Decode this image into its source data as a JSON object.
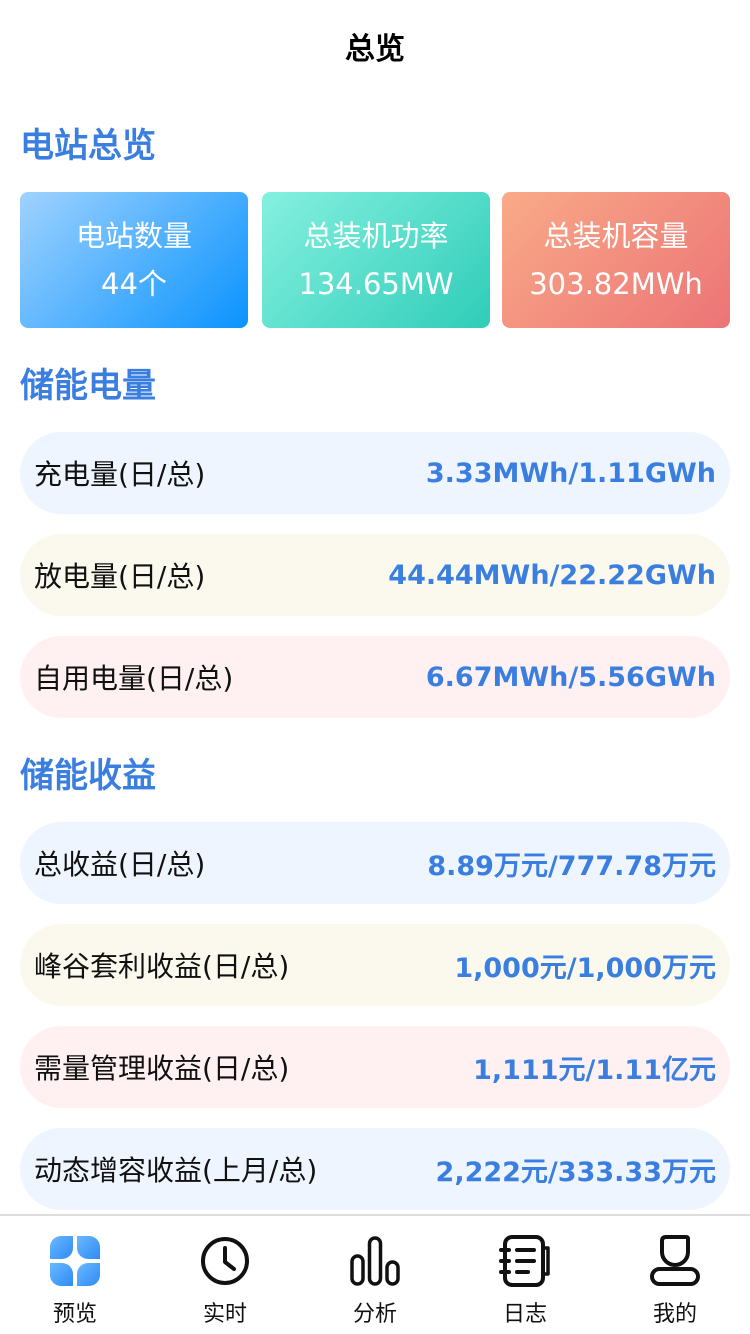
{
  "header": {
    "title": "总览"
  },
  "overview": {
    "title": "电站总览",
    "cards": [
      {
        "label": "电站数量",
        "value": "44个"
      },
      {
        "label": "总装机功率",
        "value": "134.65MW"
      },
      {
        "label": "总装机容量",
        "value": "303.82MWh"
      }
    ]
  },
  "energy": {
    "title": "储能电量",
    "rows": [
      {
        "label": "充电量(日/总)",
        "value": "3.33MWh/1.11GWh"
      },
      {
        "label": "放电量(日/总)",
        "value": "44.44MWh/22.22GWh"
      },
      {
        "label": "自用电量(日/总)",
        "value": "6.67MWh/5.56GWh"
      }
    ]
  },
  "revenue": {
    "title": "储能收益",
    "rows": [
      {
        "label": "总收益(日/总)",
        "value": "8.89万元/777.78万元"
      },
      {
        "label": "峰谷套利收益(日/总)",
        "value": "1,000元/1,000万元"
      },
      {
        "label": "需量管理收益(日/总)",
        "value": "1,111元/1.11亿元"
      },
      {
        "label": "动态增容收益(上月/总)",
        "value": "2,222元/333.33万元"
      }
    ]
  },
  "tabbar": {
    "items": [
      {
        "label": "预览",
        "icon": "grid-icon",
        "active": true
      },
      {
        "label": "实时",
        "icon": "clock-icon"
      },
      {
        "label": "分析",
        "icon": "bar-chart-icon"
      },
      {
        "label": "日志",
        "icon": "notebook-icon"
      },
      {
        "label": "我的",
        "icon": "user-icon"
      }
    ]
  },
  "colors": {
    "accent": "#3a7fe0",
    "tab_active": "#3f9bff"
  }
}
